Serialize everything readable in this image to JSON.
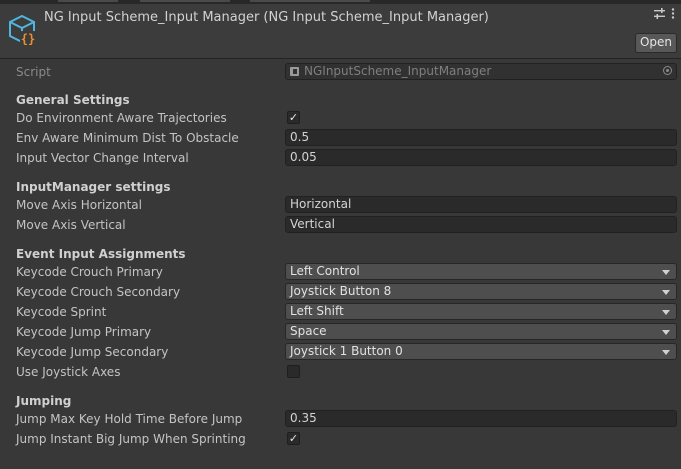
{
  "header": {
    "title": "NG Input Scheme_Input Manager (NG Input Scheme_Input Manager)",
    "open_label": "Open",
    "icons": [
      "scriptable-object-icon",
      "settings-sliders-icon",
      "more-vert-icon"
    ]
  },
  "script": {
    "label": "Script",
    "value": "NGInputScheme_InputManager"
  },
  "sections": {
    "general": "General Settings",
    "inputmanager": "InputManager settings",
    "event": "Event Input Assignments",
    "jumping": "Jumping"
  },
  "fields": {
    "do_env_aware": {
      "label": "Do Environment Aware Trajectories",
      "checked": true
    },
    "env_min_dist": {
      "label": "Env Aware Minimum Dist To Obstacle",
      "value": "0.5"
    },
    "input_vec_interval": {
      "label": "Input Vector Change Interval",
      "value": "0.05"
    },
    "move_axis_h": {
      "label": "Move Axis Horizontal",
      "value": "Horizontal"
    },
    "move_axis_v": {
      "label": "Move Axis Vertical",
      "value": "Vertical"
    },
    "crouch_primary": {
      "label": "Keycode Crouch Primary",
      "value": "Left Control"
    },
    "crouch_secondary": {
      "label": "Keycode Crouch Secondary",
      "value": "Joystick Button 8"
    },
    "sprint": {
      "label": "Keycode Sprint",
      "value": "Left Shift"
    },
    "jump_primary": {
      "label": "Keycode Jump Primary",
      "value": "Space"
    },
    "jump_secondary": {
      "label": "Keycode Jump Secondary",
      "value": "Joystick 1 Button 0"
    },
    "use_joystick": {
      "label": "Use Joystick Axes",
      "checked": false
    },
    "jump_hold_time": {
      "label": "Jump Max Key Hold Time Before Jump",
      "value": "0.35"
    },
    "jump_big_sprint": {
      "label": "Jump Instant Big Jump When Sprinting",
      "checked": true
    }
  },
  "colors": {
    "background": "#383838",
    "header": "#3c3c3c",
    "field": "#2a2a2a",
    "dropdown": "#4e4e4e",
    "icon_blue": "#4fb6e0",
    "icon_orange": "#e8912c"
  }
}
